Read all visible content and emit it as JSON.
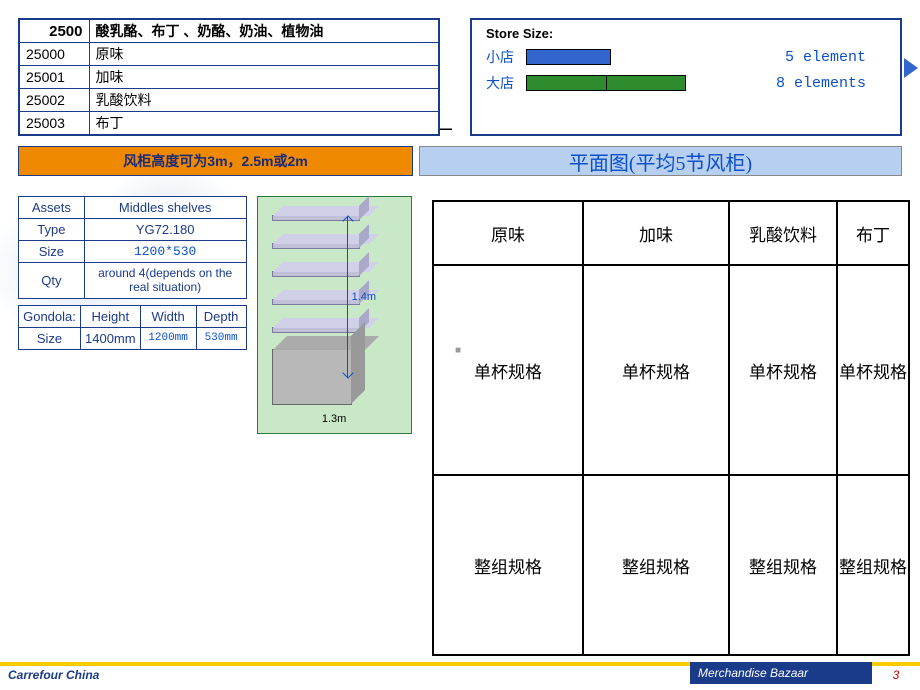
{
  "categories": {
    "header": {
      "code": "2500",
      "desc": "酸乳酪、布丁 、奶酪、奶油、植物油"
    },
    "rows": [
      {
        "code": "25000",
        "desc": "原味"
      },
      {
        "code": "25001",
        "desc": "加味"
      },
      {
        "code": "25002",
        "desc": "乳酸饮料"
      },
      {
        "code": "25003",
        "desc": "布丁"
      }
    ]
  },
  "store_size": {
    "title": "Store Size:",
    "small_label": "小店",
    "small_text": "5 element",
    "large_label": "大店",
    "large_text": "8 elements"
  },
  "bands": {
    "orange": "风柜高度可为3m，2.5m或2m",
    "blue": "平面图(平均5节风柜)"
  },
  "assets": {
    "r1": {
      "lab": "Assets",
      "val": "Middles shelves"
    },
    "r2": {
      "lab": "Type",
      "val": "YG72.180"
    },
    "r3": {
      "lab": "Size",
      "val": "1200*530"
    },
    "r4": {
      "lab": "Qty",
      "val": "around 4(depends on the real situation)"
    }
  },
  "gondola": {
    "h1": "Gondola:",
    "h2": "Height",
    "h3": "Width",
    "h4": "Depth",
    "r1": "Size",
    "r2": "1400mm",
    "r3": "1200mm",
    "r4": "530mm"
  },
  "shelf": {
    "height": "1.4m",
    "width": "1.3m"
  },
  "plan": {
    "headers": [
      "原味",
      "加味",
      "乳酸饮料",
      "布丁"
    ],
    "row2": [
      "单杯规格",
      "单杯规格",
      "单杯规格",
      "单杯规格"
    ],
    "row3": [
      "整组规格",
      "整组规格",
      "整组规格",
      "整组规格"
    ]
  },
  "footer": {
    "left": "Carrefour China",
    "mid": "Merchandise Bazaar",
    "page": "3"
  }
}
